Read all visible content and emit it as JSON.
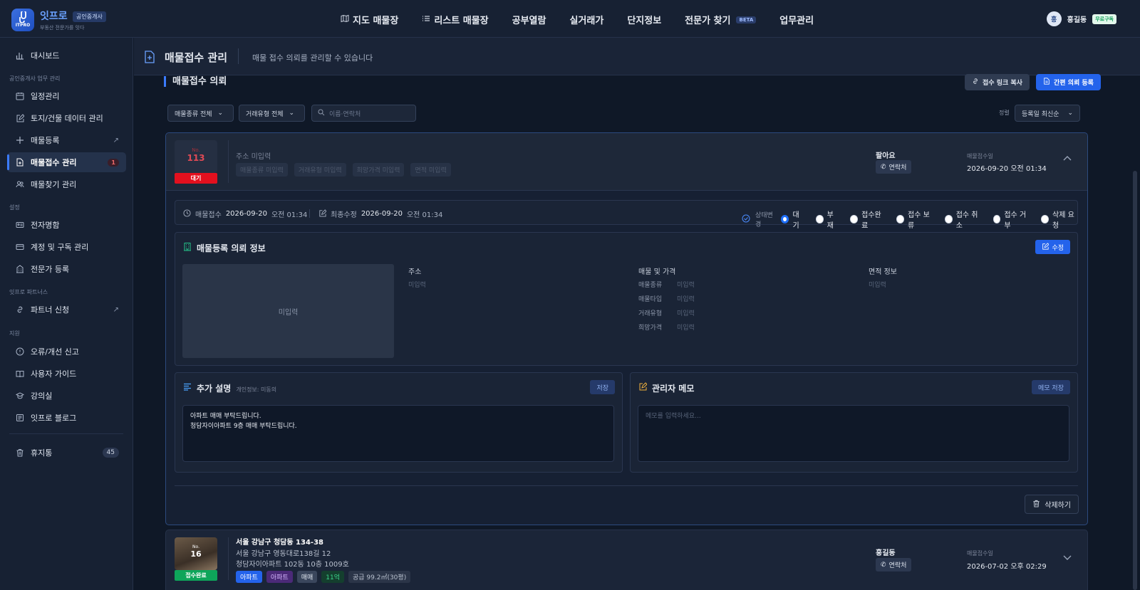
{
  "brand": {
    "name": "잇프로",
    "badge": "공인중개사",
    "tagline": "부동산 전문가를 잇다",
    "logo_text": "ITPRO"
  },
  "nav": [
    {
      "label": "지도 매물장",
      "icon": "map-icon"
    },
    {
      "label": "리스트 매물장",
      "icon": "list-icon"
    },
    {
      "label": "공부열람"
    },
    {
      "label": "실거래가"
    },
    {
      "label": "단지정보"
    },
    {
      "label": "전문가 찾기",
      "badge": "BETA"
    },
    {
      "label": "업무관리"
    }
  ],
  "user": {
    "initial": "홍",
    "name": "홍길동",
    "plan": "무료구독"
  },
  "sidebar": {
    "dashboard": "대시보드",
    "section_agent": "공인중개사 업무 관리",
    "schedule": "일정관리",
    "land": "토지/건물 데이터 관리",
    "register": "매물등록",
    "intake": "매물접수 관리",
    "intake_count": "1",
    "find": "매물찾기 관리",
    "section_settings": "설정",
    "card": "전자명함",
    "account": "계정 및 구독 관리",
    "expert": "전문가 등록",
    "section_partner": "잇프로 파트너스",
    "partner": "파트너 신청",
    "section_support": "지원",
    "report": "오류/개선 신고",
    "guide": "사용자 가이드",
    "lecture": "강의실",
    "blog": "잇프로 블로그",
    "trash": "휴지통",
    "trash_count": "45"
  },
  "page": {
    "title": "매물접수 관리",
    "desc": "매물 접수 의뢰를 관리할 수 있습니다"
  },
  "section": {
    "title": "매물접수 의뢰",
    "copy_link": "접수 링크 복사",
    "quick_register": "간편 의뢰 등록"
  },
  "filters": {
    "type": "매물종류 전체",
    "deal": "거래유형 전체",
    "search_placeholder": "이름·연락처",
    "sort_label": "정렬",
    "sort_value": "등록일 최신순"
  },
  "card1": {
    "no_label": "No.",
    "no": "113",
    "status": "대기",
    "address": "주소 미입력",
    "tags": [
      "매물종류 미입력",
      "거래유형 미입력",
      "희망가격 미입력",
      "면적 미입력"
    ],
    "seller": "팔아요",
    "contact": "연락처",
    "recv_label": "매물접수일",
    "recv_date": "2026-09-20",
    "recv_time": "오전 01:34",
    "meta_recv_label": "매물접수",
    "meta_recv_date": "2026-09-20",
    "meta_recv_time": "오전 01:34",
    "meta_mod_label": "최종수정",
    "meta_mod_date": "2026-09-20",
    "meta_mod_time": "오전 01:34",
    "status_change": "상태변경",
    "status_options": [
      "대기",
      "부재",
      "접수완료",
      "접수 보류",
      "접수 취소",
      "접수 거부",
      "삭제 요청"
    ],
    "status_selected": "대기",
    "info_title": "매물등록 의뢰 정보",
    "edit": "수정",
    "image_placeholder": "미입력",
    "addr_header": "주소",
    "addr_value": "미입력",
    "price_header": "매물 및 가격",
    "fields": [
      {
        "label": "매물종류",
        "value": "미입력"
      },
      {
        "label": "매물타입",
        "value": "미입력"
      },
      {
        "label": "거래유형",
        "value": "미입력"
      },
      {
        "label": "희망가격",
        "value": "미입력"
      }
    ],
    "area_header": "면적 정보",
    "area_value": "미입력",
    "desc_title": "추가 설명",
    "desc_sub": "개인정보: 미동의",
    "save": "저장",
    "desc_text_1": "아파트 매매 부탁드립니다.",
    "desc_text_2": "청담자이아파트 9층 매매 부탁드립니다.",
    "memo_title": "관리자 메모",
    "memo_save": "메모 저장",
    "memo_placeholder": "메모를 입력하세요...",
    "delete": "삭제하기"
  },
  "card2": {
    "no_label": "No.",
    "no": "16",
    "status": "접수완료",
    "addr1": "서울 강남구 청담동 134-38",
    "addr2": "서울 강남구 영동대로138길 12",
    "addr3": "청담자이아파트 102동 10층 1009호",
    "tags": [
      "아파트",
      "아파트",
      "매매",
      "11억",
      "공급 99.2㎡(30평)"
    ],
    "seller": "홍길동",
    "contact": "연락처",
    "recv_label": "매물접수일",
    "recv_date": "2026-07-02",
    "recv_time": "오후 02:29"
  },
  "colors": {
    "accent": "#2463eb",
    "danger": "#e3101e",
    "success": "#0ea55a"
  }
}
